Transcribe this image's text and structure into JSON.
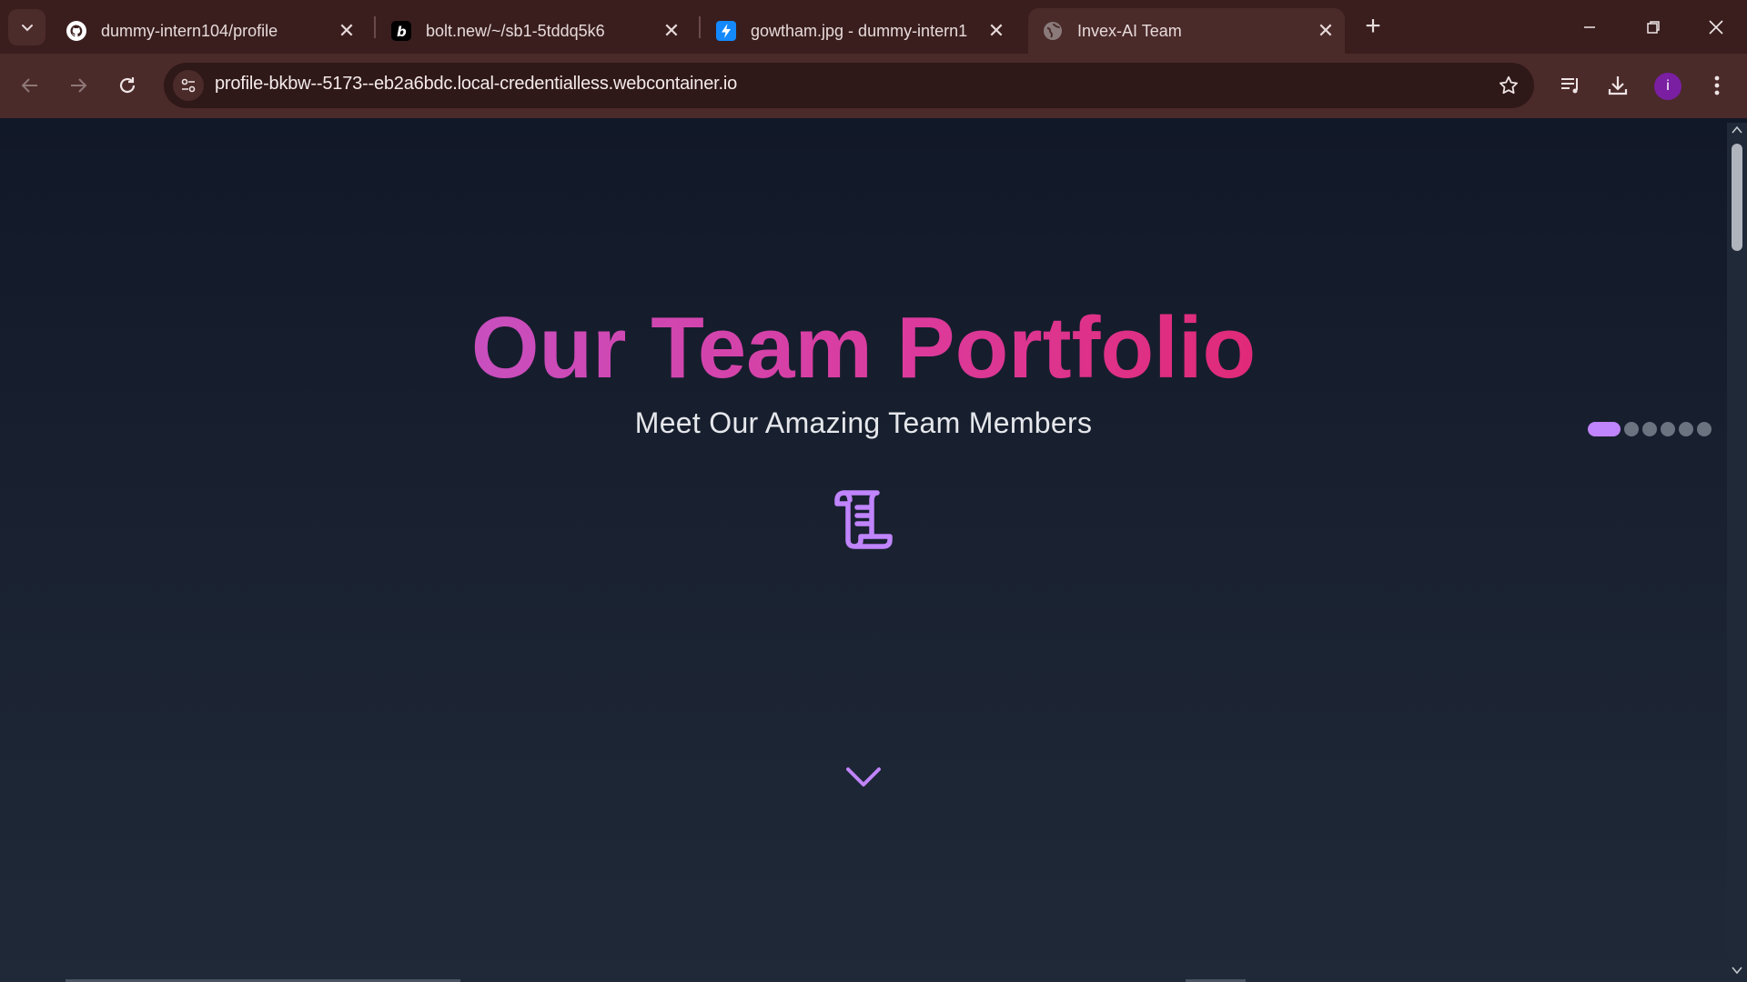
{
  "browser": {
    "tabs": [
      {
        "title": "dummy-intern104/profile",
        "icon": "github-icon"
      },
      {
        "title": "bolt.new/~/sb1-5tddq5k6",
        "icon": "bolt-icon"
      },
      {
        "title": "gowtham.jpg - dummy-intern1",
        "icon": "stackblitz-icon"
      },
      {
        "title": "Invex-AI Team",
        "icon": "globe-icon"
      }
    ],
    "address_bar": {
      "url": "profile-bkbw--5173--eb2a6bdc.local-credentialless.webcontainer.io"
    },
    "profile_initial": "i"
  },
  "page": {
    "hero": {
      "title": "Our Team Portfolio",
      "subtitle": "Meet Our Amazing Team Members",
      "icon": "scroll-icon",
      "scroll_hint_icon": "chevron-down-icon"
    },
    "pagination": {
      "total": 6,
      "active_index": 0
    }
  },
  "colors": {
    "title_gradient": [
      "#c84fbf",
      "#e02a78"
    ],
    "accent": "#c084fc",
    "background": "#111827",
    "chrome": "#4b2a2a"
  }
}
